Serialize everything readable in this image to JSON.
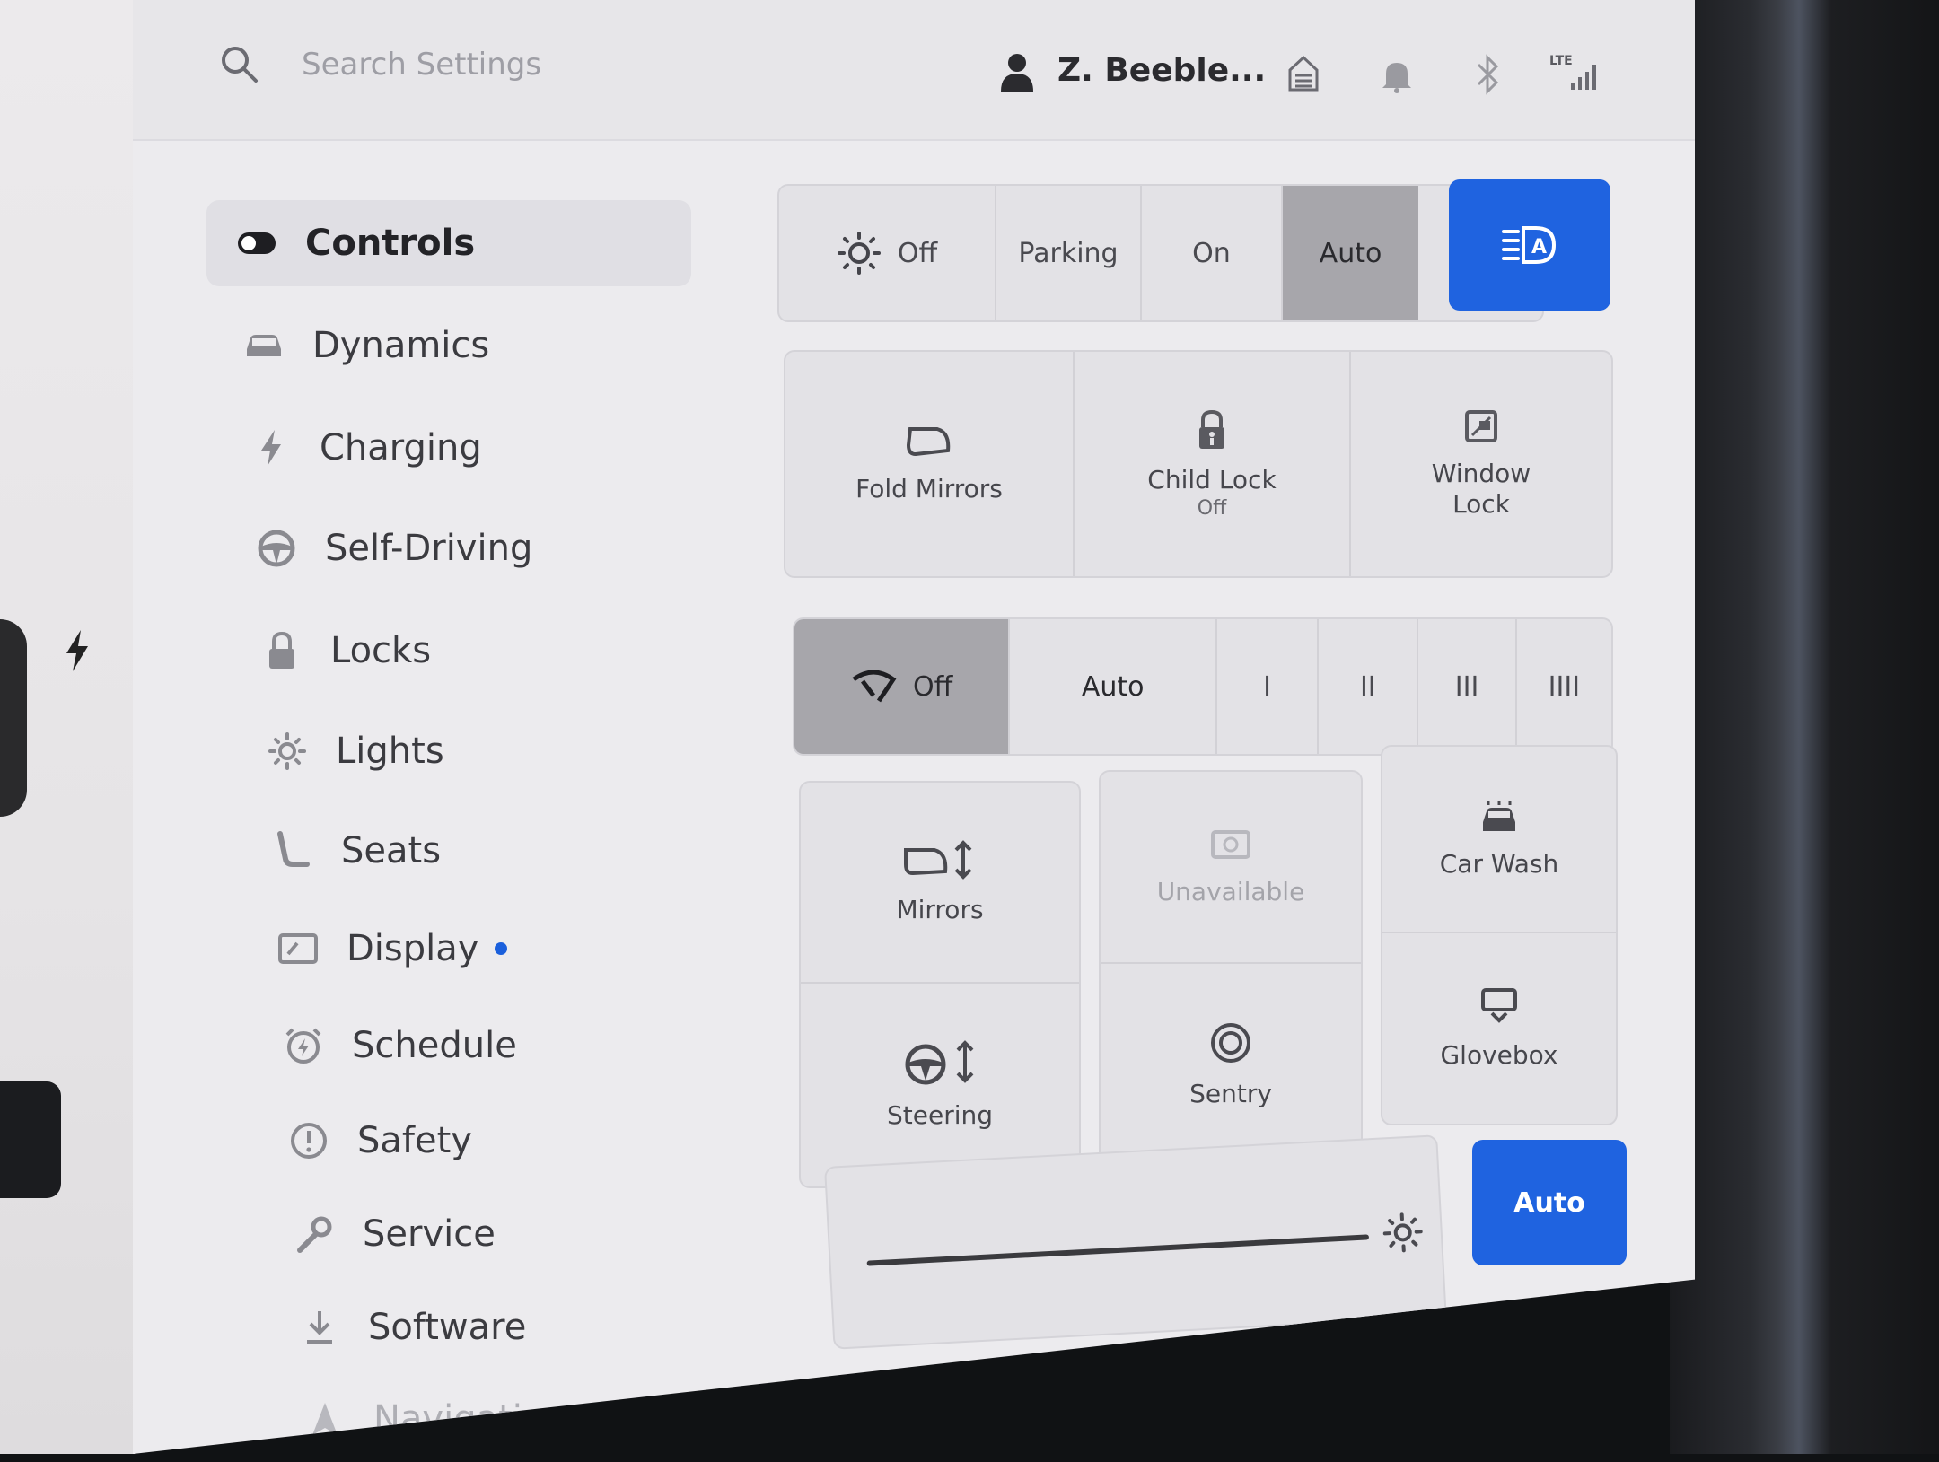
{
  "topbar": {
    "search_placeholder": "Search Settings",
    "user_name": "Z. Beeble...",
    "network_label": "LTE"
  },
  "sidebar": {
    "items": [
      {
        "label": "Controls",
        "icon": "toggle-icon",
        "active": true
      },
      {
        "label": "Dynamics",
        "icon": "car-icon"
      },
      {
        "label": "Charging",
        "icon": "bolt-icon"
      },
      {
        "label": "Self-Driving",
        "icon": "steering-wheel-icon"
      },
      {
        "label": "Locks",
        "icon": "lock-icon"
      },
      {
        "label": "Lights",
        "icon": "sun-icon"
      },
      {
        "label": "Seats",
        "icon": "seat-icon"
      },
      {
        "label": "Display",
        "icon": "display-icon",
        "badge": true
      },
      {
        "label": "Schedule",
        "icon": "alarm-icon"
      },
      {
        "label": "Safety",
        "icon": "alert-circle-icon"
      },
      {
        "label": "Service",
        "icon": "wrench-icon"
      },
      {
        "label": "Software",
        "icon": "download-icon"
      },
      {
        "label": "Navigation",
        "icon": "navigation-icon"
      }
    ]
  },
  "headlights": {
    "options": [
      "Off",
      "Parking",
      "On",
      "Auto"
    ],
    "selected": "Auto",
    "auto_high_beam_icon": "auto-high-beam-icon"
  },
  "quick_tiles_1": {
    "fold_mirrors": "Fold Mirrors",
    "child_lock": "Child Lock",
    "child_lock_status": "Off",
    "window_lock_line1": "Window",
    "window_lock_line2": "Lock"
  },
  "wipers": {
    "options": [
      "Off",
      "Auto",
      "I",
      "II",
      "III",
      "IIII"
    ],
    "selected": "Off"
  },
  "quick_tiles_2": {
    "mirrors": "Mirrors",
    "steering": "Steering",
    "unavailable": "Unavailable",
    "sentry": "Sentry",
    "car_wash": "Car Wash",
    "glovebox": "Glovebox"
  },
  "brightness": {
    "auto_label": "Auto"
  },
  "colors": {
    "accent_blue": "#1f63e0",
    "selected_grey": "#a7a6ab",
    "panel": "#e3e2e6"
  }
}
